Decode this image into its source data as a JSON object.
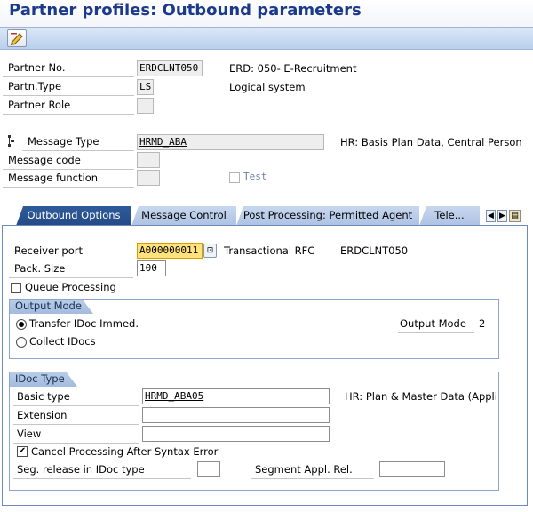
{
  "page": {
    "title": "Partner profiles: Outbound parameters"
  },
  "toolbar": {
    "edit_icon": "display-change-icon"
  },
  "header": {
    "partner_no": {
      "label": "Partner No.",
      "value": "ERDCLNT050",
      "desc": "ERD: 050- E-Recruitment"
    },
    "partn_type": {
      "label": "Partn.Type",
      "value": "LS",
      "desc": "Logical system"
    },
    "partner_role": {
      "label": "Partner Role",
      "value": ""
    },
    "message_type": {
      "label": "Message Type",
      "value": "HRMD_ABA",
      "desc": "HR: Basis Plan Data, Central Person"
    },
    "message_code": {
      "label": "Message code",
      "value": ""
    },
    "message_function": {
      "label": "Message function",
      "value": ""
    },
    "test": {
      "label": "Test",
      "checked": false
    }
  },
  "tabs": [
    {
      "label": "Outbound Options",
      "active": true
    },
    {
      "label": "Message Control",
      "active": false
    },
    {
      "label": "Post Processing: Permitted Agent",
      "active": false
    },
    {
      "label": "Tele...",
      "active": false
    }
  ],
  "outbound": {
    "receiver_port": {
      "label": "Receiver port",
      "value": "A000000011",
      "type": "Transactional RFC",
      "desc": "ERDCLNT050"
    },
    "pack_size": {
      "label": "Pack. Size",
      "value": "100"
    },
    "queue_processing": {
      "label": "Queue Processing",
      "checked": false
    },
    "output_mode": {
      "title": "Output Mode",
      "transfer_immed": {
        "label": "Transfer IDoc Immed.",
        "selected": true
      },
      "collect": {
        "label": "Collect IDocs",
        "selected": false
      },
      "mode_label": "Output Mode",
      "mode_value": "2"
    },
    "idoc_type": {
      "title": "IDoc Type",
      "basic_type": {
        "label": "Basic type",
        "value": "HRMD_ABA05",
        "desc": "HR: Plan & Master Data (Applic"
      },
      "extension": {
        "label": "Extension",
        "value": ""
      },
      "view": {
        "label": "View",
        "value": ""
      },
      "cancel_processing": {
        "label": "Cancel Processing After Syntax Error",
        "checked": true
      },
      "seg_release": {
        "label": "Seg. release in IDoc type",
        "value": ""
      },
      "segment_appl_rel": {
        "label": "Segment Appl. Rel.",
        "value": ""
      }
    }
  }
}
